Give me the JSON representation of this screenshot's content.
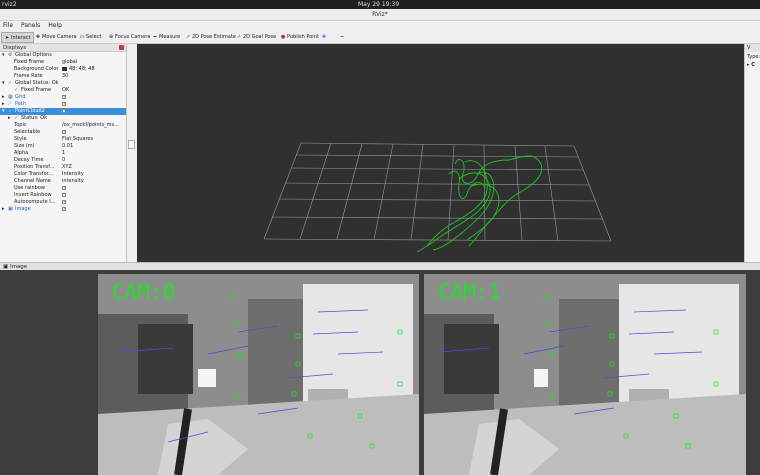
{
  "system_bar": {
    "app_label": "rviz2",
    "clock": "May 29  19:39"
  },
  "window": {
    "title": "RViz*"
  },
  "menu": {
    "file": "File",
    "panels": "Panels",
    "help": "Help"
  },
  "toolbar": {
    "interact": "Interact",
    "move_camera": "Move Camera",
    "select": "Select",
    "focus_camera": "Focus Camera",
    "measure": "Measure",
    "pose_estimate": "2D Pose Estimate",
    "goal_pose": "2D Goal Pose",
    "publish_point": "Publish Point"
  },
  "displays": {
    "title": "Displays",
    "global_options": "Global Options",
    "fixed_frame_key": "Fixed Frame",
    "fixed_frame_val": "global",
    "bg_color_key": "Background Color",
    "bg_color_val": "48; 48; 48",
    "frame_rate_key": "Frame Rate",
    "frame_rate_val": "30",
    "global_status": "Global Status: Ok",
    "fixed_frame_status_key": "Fixed Frame",
    "fixed_frame_status_val": "OK",
    "grid": "Grid",
    "path": "Path",
    "pointcloud": "PointCloud2",
    "status_ok": "Status: Ok",
    "topic_key": "Topic",
    "topic_val": "/ov_msckf/points_ms...",
    "selectable_key": "Selectable",
    "style_key": "Style",
    "style_val": "Flat Squares",
    "size_key": "Size (m)",
    "size_val": "0.01",
    "alpha_key": "Alpha",
    "alpha_val": "1",
    "decay_key": "Decay Time",
    "decay_val": "0",
    "pos_key": "Position Transf...",
    "pos_val": "XYZ",
    "color_key": "Color Transfor...",
    "color_val": "Intensity",
    "channel_key": "Channel Name",
    "channel_val": "intensity",
    "rainbow_key": "Use rainbow",
    "invert_key": "Invert Rainbow",
    "autocompute_key": "Autocompute I...",
    "image": "Image"
  },
  "right_panel": {
    "title": "V",
    "type_label": "Type:"
  },
  "image_panel": {
    "title": "Image",
    "cam0": "CAM:0",
    "cam1": "CAM:1"
  },
  "colors": {
    "background": "#303030",
    "grid": "#a0a0a0",
    "path": "#1fc21f",
    "selection": "#3a8fd8"
  }
}
